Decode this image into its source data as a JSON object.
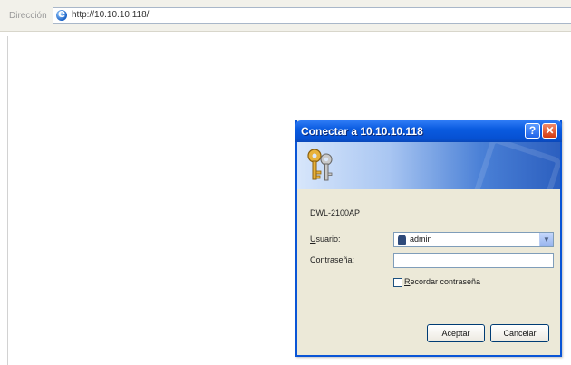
{
  "browser": {
    "address_label": "Dirección",
    "url": "http://10.10.10.118/"
  },
  "dialog": {
    "title": "Conectar a 10.10.10.118",
    "help_glyph": "?",
    "close_glyph": "✕",
    "realm": "DWL-2100AP",
    "username_label_accel": "U",
    "username_label_rest": "suario:",
    "username_value": "admin",
    "password_label_accel": "C",
    "password_label_rest": "ontraseña:",
    "password_value": "",
    "remember_accel": "R",
    "remember_rest": "ecordar contraseña",
    "remember_checked": false,
    "ok_label": "Aceptar",
    "cancel_label": "Cancelar",
    "dropdown_glyph": "▼"
  },
  "colors": {
    "titlebar": "#0a5be0",
    "dialog_border": "#0a55d6",
    "dialog_bg": "#ece9d8",
    "close_button": "#d33a10"
  },
  "icons": [
    "internet-explorer-icon",
    "keys-icon",
    "user-icon",
    "help-icon",
    "close-icon",
    "chevron-down-icon"
  ]
}
